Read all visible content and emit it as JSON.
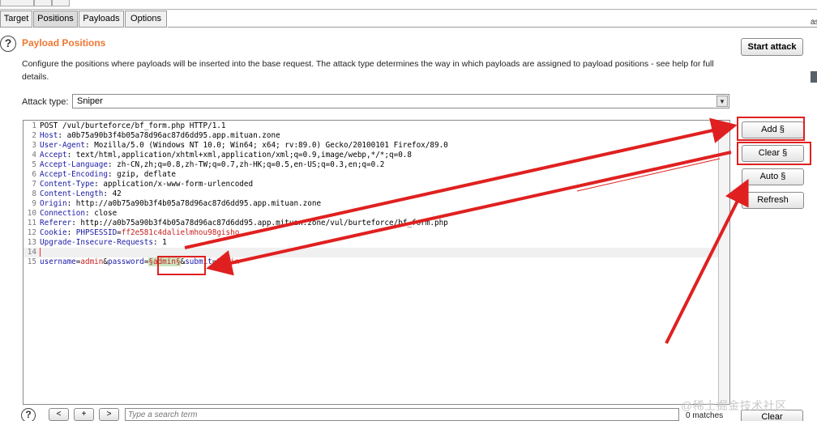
{
  "tabs": [
    {
      "label": "Target",
      "active": false
    },
    {
      "label": "Positions",
      "active": true
    },
    {
      "label": "Payloads",
      "active": false
    },
    {
      "label": "Options",
      "active": false
    }
  ],
  "right_edge_text": "as",
  "help_icon": "?",
  "section": {
    "title": "Payload Positions",
    "description": "Configure the positions where payloads will be inserted into the base request. The attack type determines the way in which payloads are assigned to payload positions - see help for full details."
  },
  "attack_type": {
    "label": "Attack type:",
    "value": "Sniper"
  },
  "buttons": {
    "start_attack": "Start attack",
    "add": "Add §",
    "clear": "Clear §",
    "auto": "Auto §",
    "refresh": "Refresh"
  },
  "request": {
    "lines": [
      {
        "n": "1",
        "key": "",
        "val": "POST /vul/burteforce/bf_form.php HTTP/1.1"
      },
      {
        "n": "2",
        "key": "Host",
        "val": "a0b75a90b3f4b05a78d96ac87d6dd95.app.mituan.zone"
      },
      {
        "n": "3",
        "key": "User-Agent",
        "val": "Mozilla/5.0 (Windows NT 10.0; Win64; x64; rv:89.0) Gecko/20100101 Firefox/89.0"
      },
      {
        "n": "4",
        "key": "Accept",
        "val": "text/html,application/xhtml+xml,application/xml;q=0.9,image/webp,*/*;q=0.8"
      },
      {
        "n": "5",
        "key": "Accept-Language",
        "val": "zh-CN,zh;q=0.8,zh-TW;q=0.7,zh-HK;q=0.5,en-US;q=0.3,en;q=0.2"
      },
      {
        "n": "6",
        "key": "Accept-Encoding",
        "val": "gzip, deflate"
      },
      {
        "n": "7",
        "key": "Content-Type",
        "val": "application/x-www-form-urlencoded"
      },
      {
        "n": "8",
        "key": "Content-Length",
        "val": "42"
      },
      {
        "n": "9",
        "key": "Origin",
        "val": "http://a0b75a90b3f4b05a78d96ac87d6dd95.app.mituan.zone"
      },
      {
        "n": "10",
        "key": "Connection",
        "val": "close"
      },
      {
        "n": "11",
        "key": "Referer",
        "val": "http://a0b75a90b3f4b05a78d96ac87d6dd95.app.mituan.zone/vul/burteforce/bf_form.php"
      },
      {
        "n": "12",
        "key": "Cookie",
        "val": "PHPSESSID=ff2e581c4dalielmhou98gisho"
      },
      {
        "n": "13",
        "key": "Upgrade-Insecure-Requests",
        "val": "1"
      },
      {
        "n": "14",
        "key": "",
        "val": ""
      }
    ],
    "body_line": {
      "n": "15",
      "p1_key": "username",
      "p1_val": "admin",
      "p2_key": "password",
      "payload": "§admin§",
      "p3_key": "submit",
      "p3_val": "Login"
    }
  },
  "search": {
    "prev": "<",
    "add": "+",
    "next": ">",
    "placeholder": "Type a search term",
    "matches": "0 matches",
    "clear": "Clear"
  },
  "watermark": "@稀土掘金技术社区",
  "annotation_color": "#e02020"
}
